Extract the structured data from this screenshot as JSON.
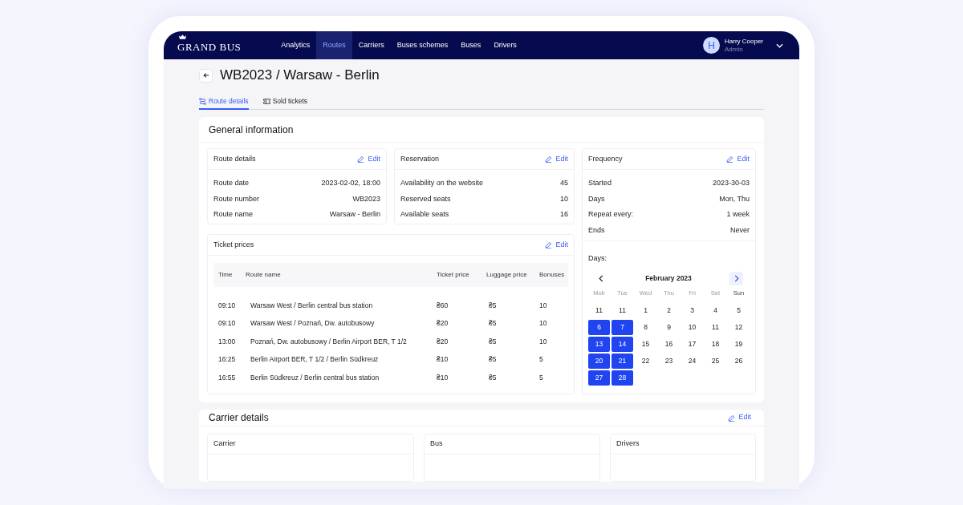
{
  "nav": {
    "logo": "GRAND BUS",
    "items": [
      {
        "label": "Analytics",
        "selected": false
      },
      {
        "label": "Routes",
        "selected": true
      },
      {
        "label": "Carriers",
        "selected": false
      },
      {
        "label": "Buses schemes",
        "selected": false
      },
      {
        "label": "Buses",
        "selected": false
      },
      {
        "label": "Drivers",
        "selected": false
      }
    ],
    "user": {
      "initial": "H",
      "name": "Harry Cooper",
      "role": "Admin"
    }
  },
  "page": {
    "title": "WB2023 / Warsaw - Berlin",
    "tabs": [
      {
        "label": "Route details",
        "selected": true,
        "kind": "route"
      },
      {
        "label": "Sold tickets",
        "selected": false,
        "kind": "ticket"
      }
    ]
  },
  "general": {
    "title": "General information",
    "route_details": {
      "title": "Route details",
      "edit": "Edit",
      "rows": [
        {
          "label": "Route date",
          "value": "2023-02-02, 18:00"
        },
        {
          "label": "Route number",
          "value": "WB2023"
        },
        {
          "label": "Route name",
          "value": "Warsaw - Berlin"
        }
      ]
    },
    "reservation": {
      "title": "Reservation",
      "edit": "Edit",
      "rows": [
        {
          "label": "Availability on the website",
          "value": "45"
        },
        {
          "label": "Reserved seats",
          "value": "10"
        },
        {
          "label": "Available seats",
          "value": "16"
        }
      ]
    },
    "ticket_prices": {
      "title": "Ticket prices",
      "edit": "Edit",
      "columns": [
        "Time",
        "Route name",
        "Ticket price",
        "Luggage price",
        "Bonuses"
      ],
      "rows": [
        [
          "09:10",
          "Warsaw West / Berlin central bus station",
          "₴60",
          "₴5",
          "10"
        ],
        [
          "09:10",
          "Warsaw West / Poznań, Dw. autobusowy",
          "₴20",
          "₴5",
          "10"
        ],
        [
          "13:00",
          "Poznań, Dw. autobusowy / Berlin Airport BER, T 1/2",
          "₴20",
          "₴5",
          "10"
        ],
        [
          "16:25",
          "Berlin Airport BER, T 1/2 / Berlin Südkreuz",
          "₴10",
          "₴5",
          "5"
        ],
        [
          "16:55",
          "Berlin Südkreuz / Berlin central bus station",
          "₴10",
          "₴5",
          "5"
        ]
      ]
    },
    "frequency": {
      "title": "Frequency",
      "edit": "Edit",
      "rows": [
        {
          "label": "Started",
          "value": "2023-30-03"
        },
        {
          "label": "Days",
          "value": "Mon, Thu"
        },
        {
          "label": "Repeat every:",
          "value": "1 week"
        },
        {
          "label": "Ends",
          "value": "Never"
        }
      ],
      "days_label": "Days:",
      "calendar": {
        "month": "February 2023",
        "weekdays": [
          "Mob",
          "Tue",
          "Wed",
          "Thu",
          "Fri",
          "Set",
          "Sun"
        ],
        "weeks": [
          [
            {
              "day": "11",
              "selected": false
            },
            {
              "day": "11",
              "selected": false
            },
            {
              "day": "1",
              "selected": false
            },
            {
              "day": "2",
              "selected": false
            },
            {
              "day": "3",
              "selected": false
            },
            {
              "day": "4",
              "selected": false
            },
            {
              "day": "5",
              "selected": false
            }
          ],
          [
            {
              "day": "6",
              "selected": true
            },
            {
              "day": "7",
              "selected": true
            },
            {
              "day": "8",
              "selected": false
            },
            {
              "day": "9",
              "selected": false
            },
            {
              "day": "10",
              "selected": false
            },
            {
              "day": "11",
              "selected": false
            },
            {
              "day": "12",
              "selected": false
            }
          ],
          [
            {
              "day": "13",
              "selected": true
            },
            {
              "day": "14",
              "selected": true
            },
            {
              "day": "15",
              "selected": false
            },
            {
              "day": "16",
              "selected": false
            },
            {
              "day": "17",
              "selected": false
            },
            {
              "day": "18",
              "selected": false
            },
            {
              "day": "19",
              "selected": false
            }
          ],
          [
            {
              "day": "20",
              "selected": true
            },
            {
              "day": "21",
              "selected": true
            },
            {
              "day": "22",
              "selected": false
            },
            {
              "day": "23",
              "selected": false
            },
            {
              "day": "24",
              "selected": false
            },
            {
              "day": "25",
              "selected": false
            },
            {
              "day": "26",
              "selected": false
            }
          ],
          [
            {
              "day": "27",
              "selected": true
            },
            {
              "day": "28",
              "selected": true
            }
          ]
        ]
      }
    }
  },
  "carrier_details": {
    "title": "Carrier details",
    "edit": "Edit",
    "panels": [
      "Carrier",
      "Bus",
      "Drivers"
    ]
  }
}
